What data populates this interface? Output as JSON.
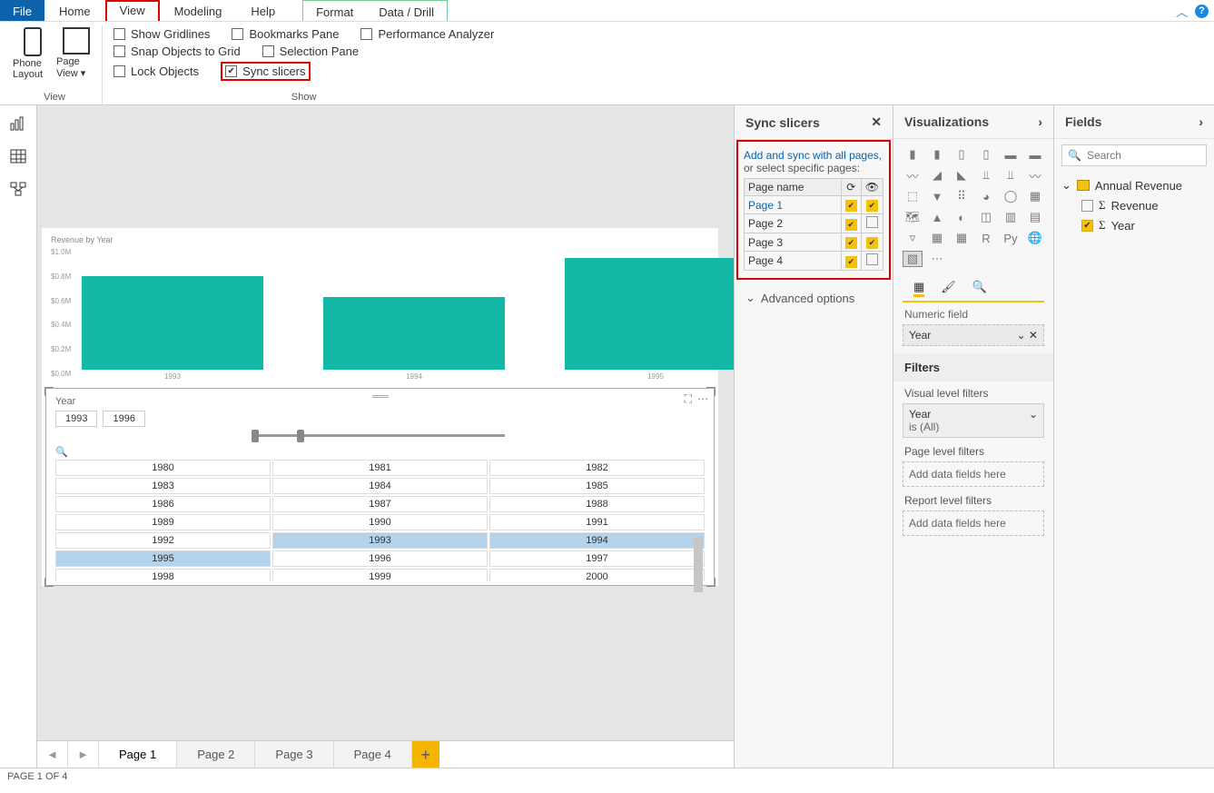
{
  "menu": {
    "file": "File",
    "home": "Home",
    "view": "View",
    "modeling": "Modeling",
    "help": "Help",
    "format": "Format",
    "datadrill": "Data / Drill"
  },
  "ribbon": {
    "phone": "Phone Layout",
    "page": "Page View",
    "view_label": "View",
    "show_label": "Show",
    "gridlines": "Show Gridlines",
    "snap": "Snap Objects to Grid",
    "lock": "Lock Objects",
    "bookmarks": "Bookmarks Pane",
    "selection": "Selection Pane",
    "sync": "Sync slicers",
    "perf": "Performance Analyzer"
  },
  "sync": {
    "title": "Sync slicers",
    "hint": "Add and sync with all pages,",
    "hint2": "or select specific pages:",
    "col": "Page name",
    "rows": [
      {
        "name": "Page 1",
        "sync": true,
        "vis": true,
        "active": true
      },
      {
        "name": "Page 2",
        "sync": true,
        "vis": false
      },
      {
        "name": "Page 3",
        "sync": true,
        "vis": true
      },
      {
        "name": "Page 4",
        "sync": true,
        "vis": false
      }
    ],
    "adv": "Advanced options"
  },
  "viz": {
    "title": "Visualizations",
    "numeric": "Numeric field",
    "field": "Year",
    "filters": "Filters",
    "vlf": "Visual level filters",
    "vlf_field": "Year",
    "vlf_val": "is (All)",
    "plf": "Page level filters",
    "rlf": "Report level filters",
    "add": "Add data fields here"
  },
  "fields": {
    "title": "Fields",
    "search": "Search",
    "table": "Annual Revenue",
    "revenue": "Revenue",
    "year": "Year"
  },
  "chart_data": {
    "type": "bar",
    "title": "Revenue by Year",
    "ylabels": [
      "$1.0M",
      "$0.8M",
      "$0.6M",
      "$0.4M",
      "$0.2M",
      "$0.0M"
    ],
    "categories": [
      "1993",
      "1994",
      "1995"
    ],
    "values": [
      0.77,
      0.6,
      0.92
    ],
    "ylim": [
      0,
      1.0
    ]
  },
  "slicer": {
    "label": "Year",
    "from": "1993",
    "to": "1996",
    "years": [
      [
        "1980",
        "1981",
        "1982"
      ],
      [
        "1983",
        "1984",
        "1985"
      ],
      [
        "1986",
        "1987",
        "1988"
      ],
      [
        "1989",
        "1990",
        "1991"
      ],
      [
        "1992",
        "1993",
        "1994"
      ],
      [
        "1995",
        "1996",
        "1997"
      ],
      [
        "1998",
        "1999",
        "2000"
      ]
    ],
    "selected": [
      "1993",
      "1994",
      "1995"
    ]
  },
  "pages": {
    "p1": "Page 1",
    "p2": "Page 2",
    "p3": "Page 3",
    "p4": "Page 4"
  },
  "status": "PAGE 1 OF 4"
}
